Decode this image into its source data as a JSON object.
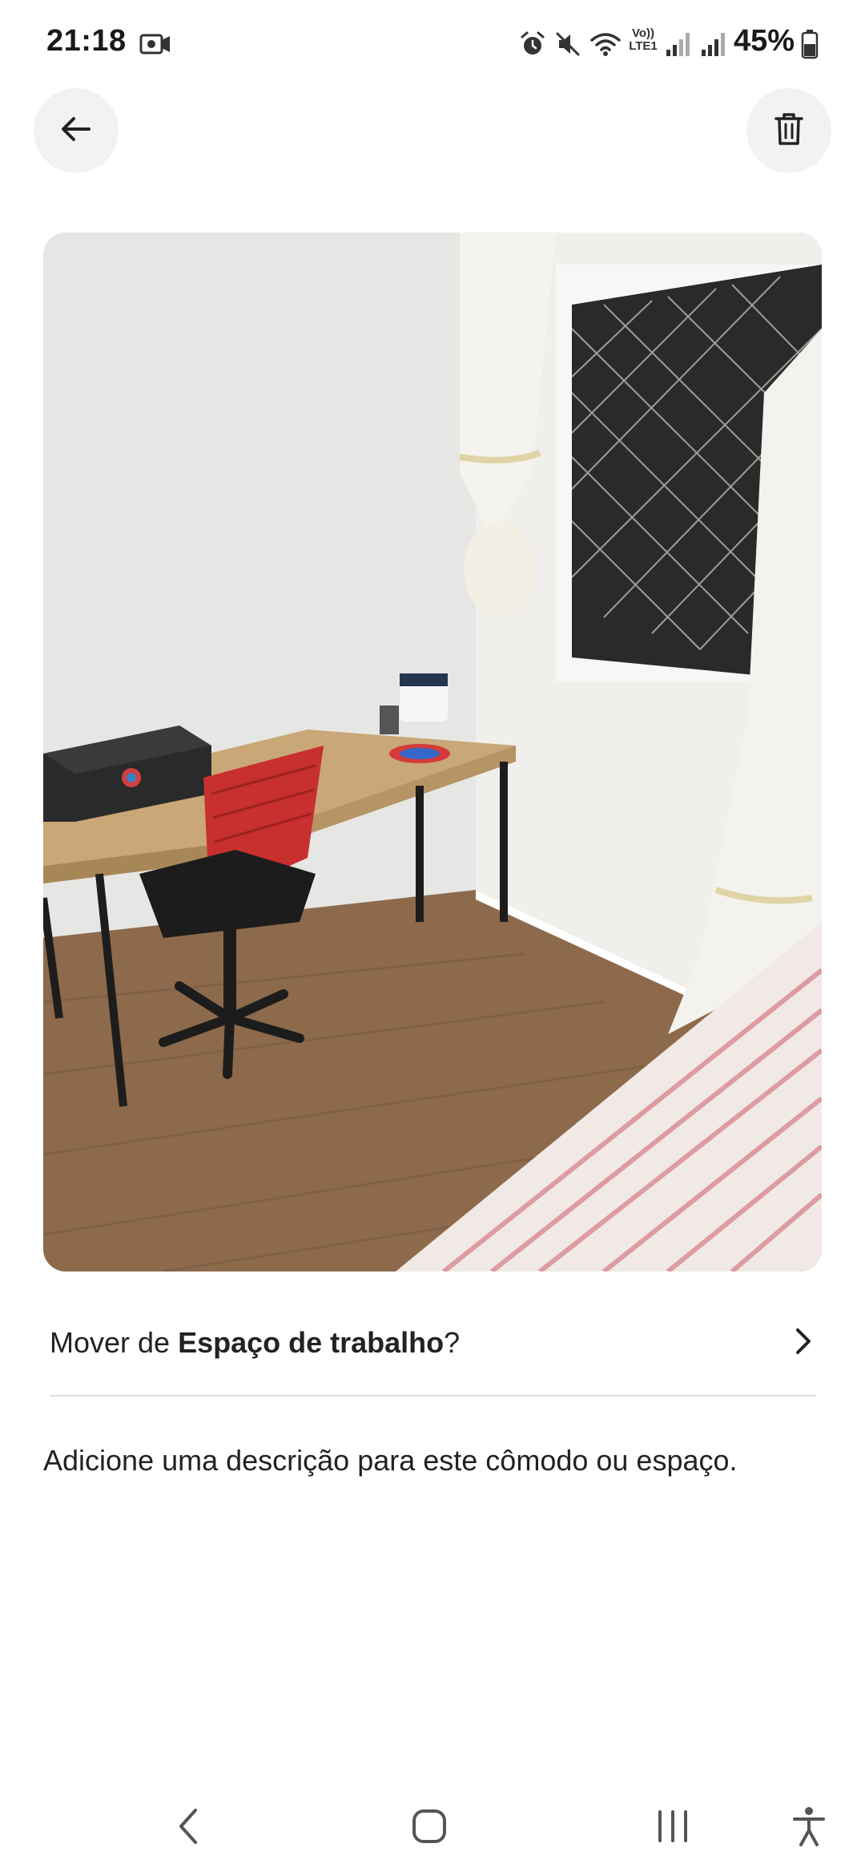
{
  "status_bar": {
    "time": "21:18",
    "battery": "45%",
    "icons": [
      "screen-record-icon",
      "alarm-icon",
      "mute-icon",
      "wifi-icon",
      "volte-icon",
      "signal-icon",
      "signal-icon",
      "battery-icon"
    ],
    "volte_label_top": "Vo))",
    "volte_label_bottom": "LTE1"
  },
  "header": {
    "back_icon": "arrow-left-icon",
    "delete_icon": "trash-icon"
  },
  "photo": {
    "subject": "workspace-room-photo"
  },
  "move": {
    "prefix": "Mover de ",
    "space_name": "Espaço de trabalho",
    "suffix": "?",
    "chevron_icon": "chevron-right-icon"
  },
  "description": {
    "placeholder": "Adicione uma descrição para este cômodo ou espaço."
  },
  "nav": {
    "icons": [
      "back-nav-icon",
      "home-nav-icon",
      "recents-nav-icon",
      "accessibility-icon"
    ]
  },
  "colors": {
    "background": "#ffffff",
    "text": "#222222",
    "button_bg": "#f2f2f2",
    "divider": "#dddddd"
  }
}
